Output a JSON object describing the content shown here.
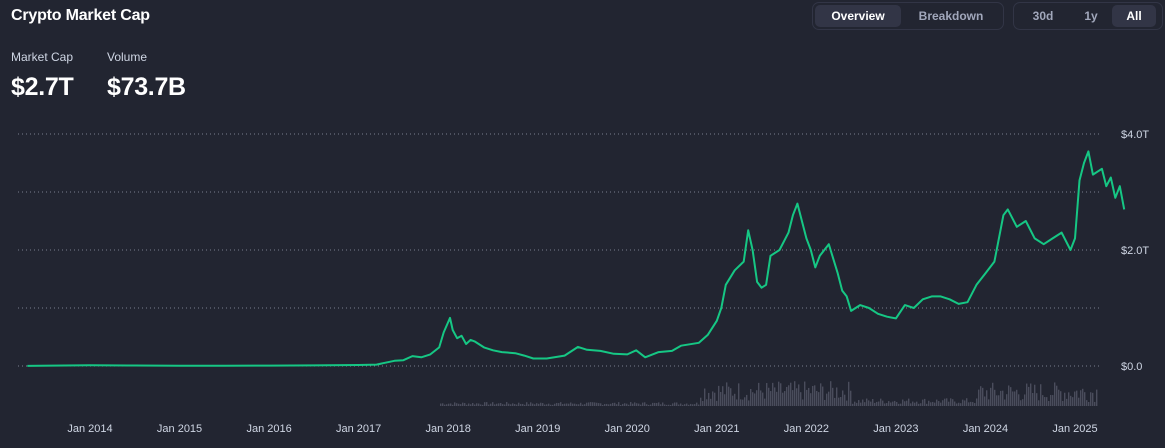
{
  "header": {
    "title": "Crypto Market Cap",
    "view_tabs": [
      {
        "label": "Overview",
        "active": true
      },
      {
        "label": "Breakdown",
        "active": false
      }
    ],
    "range_tabs": [
      {
        "label": "30d",
        "active": false
      },
      {
        "label": "1y",
        "active": false
      },
      {
        "label": "All",
        "active": true
      }
    ]
  },
  "stats": {
    "market_cap_label": "Market Cap",
    "market_cap_value": "$2.7T",
    "volume_label": "Volume",
    "volume_value": "$73.7B"
  },
  "colors": {
    "background": "#222531",
    "line": "#16c784",
    "grid": "#7a7f8e",
    "volume_bar": "#4a4d5c"
  },
  "chart_data": {
    "type": "line",
    "x_tick_labels": [
      "Jan 2014",
      "Jan 2015",
      "Jan 2016",
      "Jan 2017",
      "Jan 2018",
      "Jan 2019",
      "Jan 2020",
      "Jan 2021",
      "Jan 2022",
      "Jan 2023",
      "Jan 2024",
      "Jan 2025"
    ],
    "y_tick_labels": [
      "$4.0T",
      "$2.0T",
      "$0.0"
    ],
    "ylim": [
      0,
      4.0
    ],
    "grid": true,
    "x_unit": "year",
    "y_unit": "trillion USD",
    "series": [
      {
        "values": [
          [
            2013.3,
            0.002
          ],
          [
            2014.0,
            0.012
          ],
          [
            2014.5,
            0.009
          ],
          [
            2015.0,
            0.005
          ],
          [
            2015.5,
            0.004
          ],
          [
            2016.0,
            0.007
          ],
          [
            2016.5,
            0.011
          ],
          [
            2017.0,
            0.018
          ],
          [
            2017.2,
            0.025
          ],
          [
            2017.4,
            0.09
          ],
          [
            2017.5,
            0.1
          ],
          [
            2017.6,
            0.17
          ],
          [
            2017.7,
            0.15
          ],
          [
            2017.8,
            0.2
          ],
          [
            2017.9,
            0.32
          ],
          [
            2017.95,
            0.58
          ],
          [
            2018.02,
            0.83
          ],
          [
            2018.05,
            0.62
          ],
          [
            2018.1,
            0.48
          ],
          [
            2018.15,
            0.52
          ],
          [
            2018.2,
            0.38
          ],
          [
            2018.25,
            0.45
          ],
          [
            2018.3,
            0.42
          ],
          [
            2018.4,
            0.32
          ],
          [
            2018.5,
            0.27
          ],
          [
            2018.6,
            0.24
          ],
          [
            2018.75,
            0.22
          ],
          [
            2018.85,
            0.18
          ],
          [
            2018.95,
            0.13
          ],
          [
            2019.1,
            0.13
          ],
          [
            2019.3,
            0.18
          ],
          [
            2019.45,
            0.33
          ],
          [
            2019.55,
            0.28
          ],
          [
            2019.7,
            0.26
          ],
          [
            2019.85,
            0.21
          ],
          [
            2020.0,
            0.2
          ],
          [
            2020.1,
            0.27
          ],
          [
            2020.2,
            0.15
          ],
          [
            2020.35,
            0.24
          ],
          [
            2020.5,
            0.26
          ],
          [
            2020.6,
            0.35
          ],
          [
            2020.8,
            0.4
          ],
          [
            2020.9,
            0.54
          ],
          [
            2021.0,
            0.78
          ],
          [
            2021.05,
            1.0
          ],
          [
            2021.1,
            1.4
          ],
          [
            2021.2,
            1.65
          ],
          [
            2021.3,
            1.8
          ],
          [
            2021.35,
            2.34
          ],
          [
            2021.4,
            2.0
          ],
          [
            2021.45,
            1.45
          ],
          [
            2021.5,
            1.35
          ],
          [
            2021.55,
            1.4
          ],
          [
            2021.6,
            1.9
          ],
          [
            2021.7,
            2.0
          ],
          [
            2021.8,
            2.3
          ],
          [
            2021.85,
            2.6
          ],
          [
            2021.9,
            2.8
          ],
          [
            2021.95,
            2.5
          ],
          [
            2022.0,
            2.2
          ],
          [
            2022.05,
            2.0
          ],
          [
            2022.1,
            1.7
          ],
          [
            2022.15,
            1.9
          ],
          [
            2022.25,
            2.1
          ],
          [
            2022.35,
            1.6
          ],
          [
            2022.4,
            1.3
          ],
          [
            2022.45,
            1.2
          ],
          [
            2022.5,
            0.95
          ],
          [
            2022.6,
            1.05
          ],
          [
            2022.7,
            1.0
          ],
          [
            2022.8,
            0.9
          ],
          [
            2022.9,
            0.85
          ],
          [
            2023.0,
            0.82
          ],
          [
            2023.1,
            1.05
          ],
          [
            2023.2,
            1.0
          ],
          [
            2023.3,
            1.15
          ],
          [
            2023.4,
            1.2
          ],
          [
            2023.5,
            1.2
          ],
          [
            2023.6,
            1.15
          ],
          [
            2023.7,
            1.07
          ],
          [
            2023.8,
            1.1
          ],
          [
            2023.9,
            1.4
          ],
          [
            2024.0,
            1.6
          ],
          [
            2024.1,
            1.8
          ],
          [
            2024.15,
            2.2
          ],
          [
            2024.2,
            2.6
          ],
          [
            2024.25,
            2.7
          ],
          [
            2024.35,
            2.4
          ],
          [
            2024.45,
            2.5
          ],
          [
            2024.55,
            2.2
          ],
          [
            2024.65,
            2.1
          ],
          [
            2024.75,
            2.2
          ],
          [
            2024.85,
            2.3
          ],
          [
            2024.95,
            2.0
          ],
          [
            2025.0,
            2.2
          ],
          [
            2025.05,
            3.2
          ],
          [
            2025.1,
            3.5
          ],
          [
            2025.15,
            3.7
          ],
          [
            2025.2,
            3.3
          ],
          [
            2025.3,
            3.4
          ],
          [
            2025.35,
            3.1
          ],
          [
            2025.4,
            3.25
          ],
          [
            2025.45,
            2.9
          ],
          [
            2025.5,
            3.1
          ],
          [
            2025.55,
            2.7
          ]
        ]
      }
    ]
  }
}
